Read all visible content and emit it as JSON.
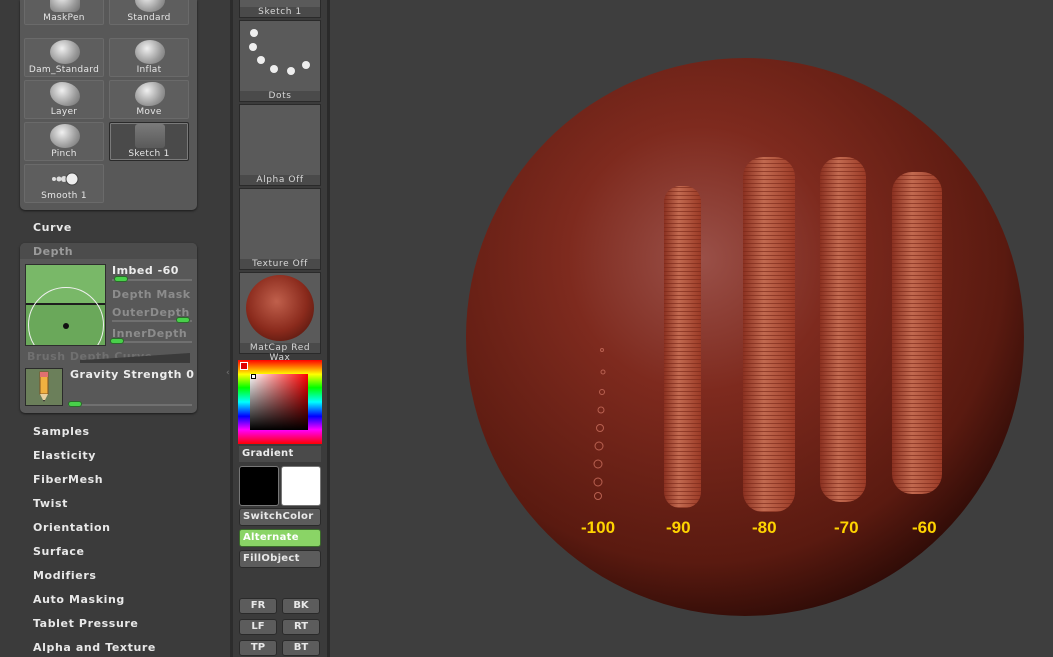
{
  "brush_palette": {
    "tiles": [
      {
        "label": "MaskPen"
      },
      {
        "label": "Standard"
      },
      {
        "label": "Dam_Standard"
      },
      {
        "label": "Inflat"
      },
      {
        "label": "Layer"
      },
      {
        "label": "Move"
      },
      {
        "label": "Pinch"
      },
      {
        "label": "Sketch 1"
      },
      {
        "label": "Smooth 1"
      }
    ],
    "selected": "Sketch 1"
  },
  "menu": {
    "curve": "Curve",
    "samples": "Samples",
    "elasticity": "Elasticity",
    "fibermesh": "FiberMesh",
    "twist": "Twist",
    "orientation": "Orientation",
    "surface": "Surface",
    "modifiers": "Modifiers",
    "auto_masking": "Auto Masking",
    "tablet_pressure": "Tablet Pressure",
    "alpha_and_texture": "Alpha and Texture"
  },
  "depth_panel": {
    "header": "Depth",
    "imbed_label": "Imbed -60",
    "imbed_value": -60,
    "depth_mask": "Depth Mask",
    "outer_depth": "OuterDepth",
    "inner_depth": "InnerDepth",
    "brush_depth_curve": "Brush Depth Curve",
    "gravity_label": "Gravity Strength 0",
    "gravity_value": 0
  },
  "mid_column": {
    "top_label": "Sketch 1",
    "stroke_label": "Dots",
    "alpha_label": "Alpha Off",
    "texture_label": "Texture Off",
    "material_label": "MatCap Red Wax",
    "gradient": "Gradient",
    "switch_color": "SwitchColor",
    "alternate": "Alternate",
    "fill_object": "FillObject",
    "view_buttons": [
      "FR",
      "BK",
      "LF",
      "RT",
      "TP",
      "BT"
    ]
  },
  "colors": {
    "main_color": "#000000",
    "secondary_color": "#ffffff",
    "accent_green": "#48d04a",
    "sphere": "#8a2a1c",
    "label_yellow": "#ffd400"
  },
  "viewport": {
    "depth_labels": [
      "-100",
      "-90",
      "-80",
      "-70",
      "-60"
    ]
  }
}
